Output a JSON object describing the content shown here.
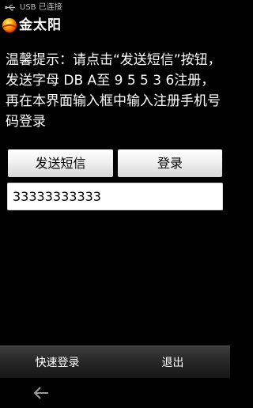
{
  "status_bar": {
    "icon": "usb-icon",
    "text": "USB 已连接"
  },
  "app": {
    "logo_icon": "sun-logo-icon",
    "title": "金太阳"
  },
  "hint": {
    "text": "温馨提示：请点击“发送短信”按钮，发送字母 DB A至 9 5 5 3 6注册，再在本界面输入框中输入注册手机号码登录"
  },
  "buttons": {
    "send_sms": "发送短信",
    "login": "登录"
  },
  "phone_input": {
    "value": "33333333333"
  },
  "bottom_menu": {
    "quick_login": "快速登录",
    "exit": "退出"
  },
  "nav": {
    "back_icon": "back-arrow-icon"
  },
  "colors": {
    "background": "#000000",
    "button_face": "#f1f1f1",
    "menu_bar": "#262626",
    "status_text": "#bfbfbf"
  }
}
